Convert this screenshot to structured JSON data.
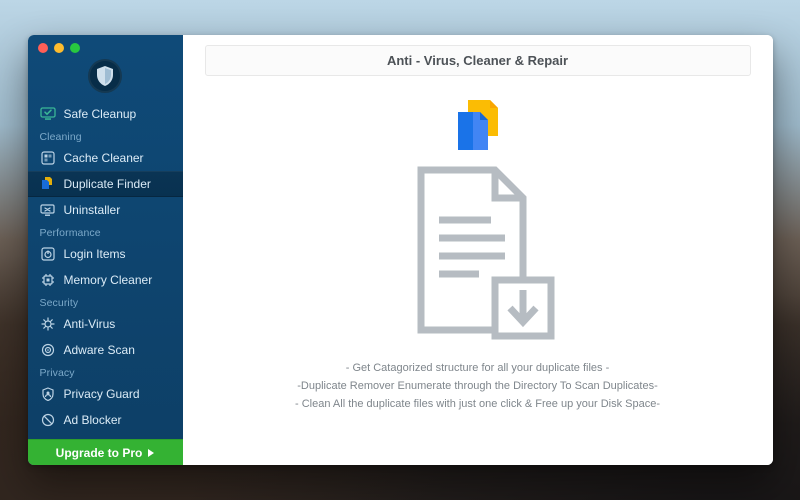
{
  "window": {
    "title": "Anti - Virus, Cleaner & Repair"
  },
  "sidebar": {
    "top_item": {
      "label": "Safe Cleanup"
    },
    "sections": {
      "cleaning": {
        "label": "Cleaning"
      },
      "performance": {
        "label": "Performance"
      },
      "security": {
        "label": "Security"
      },
      "privacy": {
        "label": "Privacy"
      }
    },
    "items": {
      "cache_cleaner": {
        "label": "Cache Cleaner"
      },
      "duplicate_finder": {
        "label": "Duplicate Finder",
        "active": true
      },
      "uninstaller": {
        "label": "Uninstaller"
      },
      "login_items": {
        "label": "Login Items"
      },
      "memory_cleaner": {
        "label": "Memory Cleaner"
      },
      "anti_virus": {
        "label": "Anti-Virus"
      },
      "adware_scan": {
        "label": "Adware Scan"
      },
      "privacy_guard": {
        "label": "Privacy Guard"
      },
      "ad_blocker": {
        "label": "Ad Blocker"
      }
    },
    "upgrade": {
      "label": "Upgrade to Pro"
    }
  },
  "main": {
    "desc_line1": "- Get Catagorized structure for all your duplicate files -",
    "desc_line2": "-Duplicate Remover Enumerate through the Directory To Scan Duplicates-",
    "desc_line3": "- Clean All the duplicate files with just one click & Free up your Disk Space-"
  },
  "colors": {
    "accent_green": "#34b233",
    "sidebar_bg": "#0f4a78",
    "doc_blue": "#1a73e8",
    "doc_yellow": "#fbbc04"
  }
}
